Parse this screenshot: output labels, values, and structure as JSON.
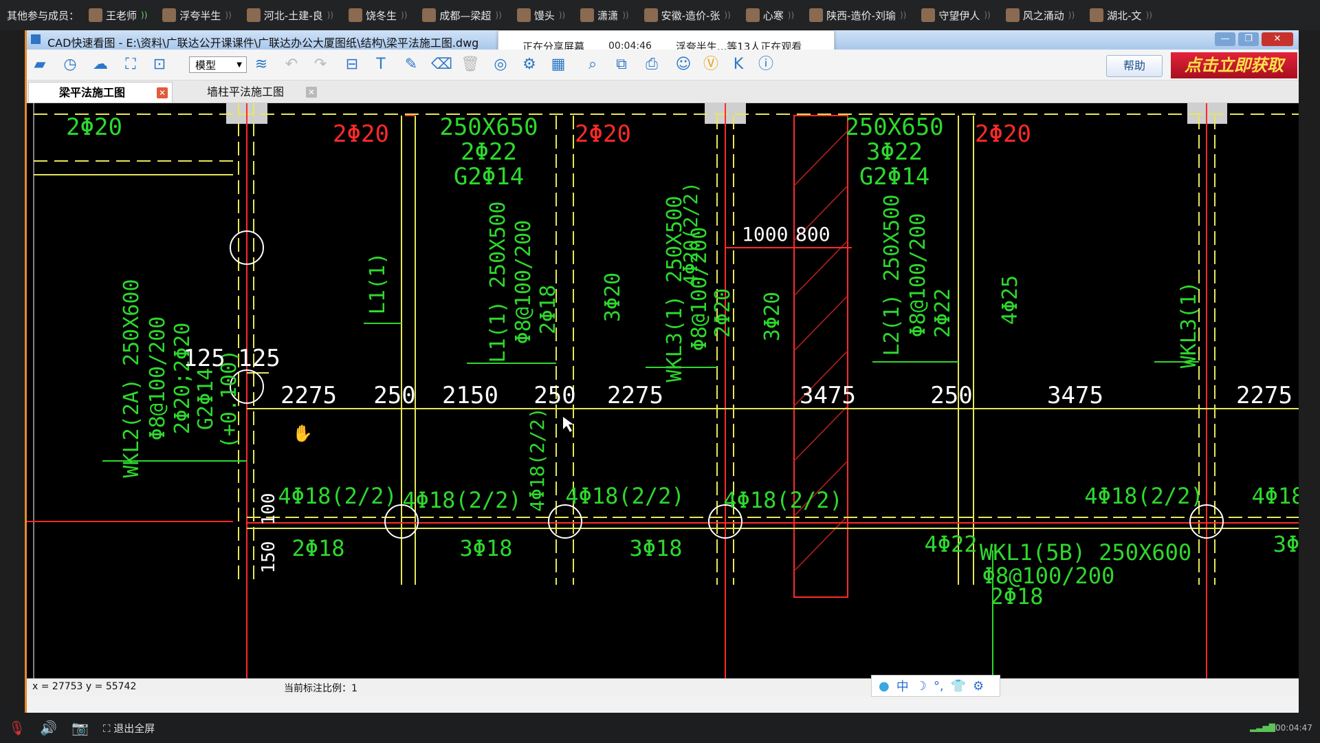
{
  "participants_bar": {
    "label": "其他参与成员：",
    "members": [
      {
        "name": "王老师",
        "speaking": true
      },
      {
        "name": "浮夸半生",
        "speaking": false
      },
      {
        "name": "河北-土建-良",
        "speaking": false
      },
      {
        "name": "饶冬生",
        "speaking": false
      },
      {
        "name": "成都—梁超",
        "speaking": false
      },
      {
        "name": "馒头",
        "speaking": false
      },
      {
        "name": "潇潇",
        "speaking": false
      },
      {
        "name": "安徽-造价-张",
        "speaking": false
      },
      {
        "name": "心寒",
        "speaking": false
      },
      {
        "name": "陕西-造价-刘瑜",
        "speaking": false
      },
      {
        "name": "守望伊人",
        "speaking": false
      },
      {
        "name": "风之涌动",
        "speaking": false
      },
      {
        "name": "湖北-文",
        "speaking": false
      }
    ]
  },
  "window": {
    "title": "CAD快速看图 - E:\\资料\\广联达公开课课件\\广联达办公大厦图纸\\结构\\梁平法施工图.dwg",
    "controls": {
      "minimize": "—",
      "maximize": "❐",
      "close": "✕"
    }
  },
  "share_banner": {
    "status": "正在分享屏幕",
    "elapsed": "00:04:46",
    "viewers": "浮夸半生...等13人正在观看"
  },
  "toolbar": {
    "mode_select": "模型",
    "help_label": "帮助",
    "promo_label": "点击立即获取"
  },
  "tabs": [
    {
      "label": "梁平法施工图",
      "active": true
    },
    {
      "label": "墙柱平法施工图",
      "active": false
    }
  ],
  "drawing": {
    "labels": [
      "2Φ20",
      "2Φ20",
      "250X650",
      "2Φ22",
      "G2Φ14",
      "2Φ20",
      "250X650",
      "3Φ22",
      "G2Φ14",
      "2Φ20",
      "4Φ20(2/2)",
      "1000",
      "800",
      "WKL2(2A) 250X600",
      "Φ8@100/200",
      "2Φ20;2Φ20",
      "G2Φ14",
      "(+0.100)",
      "L1(1)",
      "L1(1) 250X500",
      "Φ8@100/200",
      "2Φ18",
      "3Φ20",
      "WKL3(1) 250X500",
      "Φ8@100/200",
      "2Φ20",
      "3Φ20",
      "L2(1) 250X500",
      "Φ8@100/200",
      "2Φ22",
      "4Φ25",
      "WKL3(1)",
      "125",
      "125",
      "2275",
      "250",
      "2150",
      "250",
      "2275",
      "3475",
      "250",
      "3475",
      "2275",
      "4Φ18(2/2)",
      "4Φ18(2/2)",
      "4Φ18(2/2)",
      "4Φ18(2/2)",
      "4Φ18(2/2)",
      "4Φ18",
      "4Φ18(2/2)",
      "100",
      "150",
      "2Φ18",
      "3Φ18",
      "3Φ18",
      "4Φ22",
      "WKL1(5B) 250X600",
      "Φ8@100/200",
      "2Φ18",
      "3Φ"
    ]
  },
  "statusbar": {
    "coords": "x = 27753  y = 55742",
    "scale": "当前标注比例：1",
    "ime": [
      "中",
      "☽",
      "°,",
      "👕",
      "⚙"
    ]
  },
  "controls_bar": {
    "exit_fullscreen": "退出全屏",
    "time": "00:04:47"
  },
  "colors": {
    "accent_orange": "#e98b2a",
    "cad_background": "#000000",
    "cad_green": "#2ed82e",
    "cad_red": "#ff2a2a",
    "cad_yellow": "#e8e85a",
    "cad_white": "#ffffff"
  }
}
